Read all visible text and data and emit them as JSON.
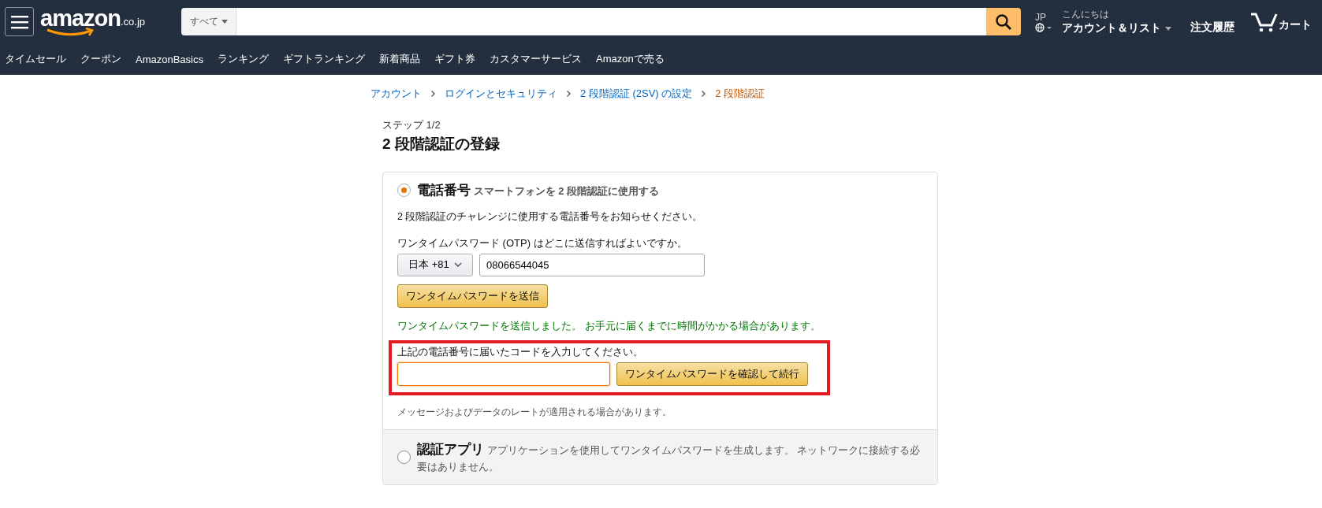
{
  "header": {
    "logo": "amazon",
    "logo_suffix": ".co.jp",
    "search_category": "すべて",
    "region_label": "JP",
    "greeting": "こんにちは",
    "account": "アカウント＆リスト",
    "orders": "注文履歴",
    "cart": "カート"
  },
  "nav": [
    "タイムセール",
    "クーポン",
    "AmazonBasics",
    "ランキング",
    "ギフトランキング",
    "新着商品",
    "ギフト券",
    "カスタマーサービス",
    "Amazonで売る"
  ],
  "breadcrumb": [
    {
      "label": "アカウント",
      "current": false
    },
    {
      "label": "ログインとセキュリティ",
      "current": false
    },
    {
      "label": "2 段階認証 (2SV) の設定",
      "current": false
    },
    {
      "label": "2 段階認証",
      "current": true
    }
  ],
  "step": "ステップ 1/2",
  "title": "2 段階認証の登録",
  "options": [
    {
      "kind": "phone",
      "selected": true,
      "title": "電話番号",
      "subtitle": "スマートフォンを 2 段階認証に使用する",
      "description": "2 段階認証のチャレンジに使用する電話番号をお知らせください。",
      "destination_label": "ワンタイムパスワード (OTP) はどこに送信すればよいですか。",
      "country": "日本 +81",
      "phone": "08066544045",
      "send_button": "ワンタイムパスワードを送信",
      "sent_message": "ワンタイムパスワードを送信しました。 お手元に届くまでに時間がかかる場合があります。",
      "code_label": "上記の電話番号に届いたコードを入力してください。",
      "verify_button": "ワンタイムパスワードを確認して続行",
      "rates_note": "メッセージおよびデータのレートが適用される場合があります。"
    },
    {
      "kind": "app",
      "selected": false,
      "title": "認証アプリ",
      "subtitle": "アプリケーションを使用してワンタイムパスワードを生成します。 ネットワークに接続する必要はありません。"
    }
  ]
}
